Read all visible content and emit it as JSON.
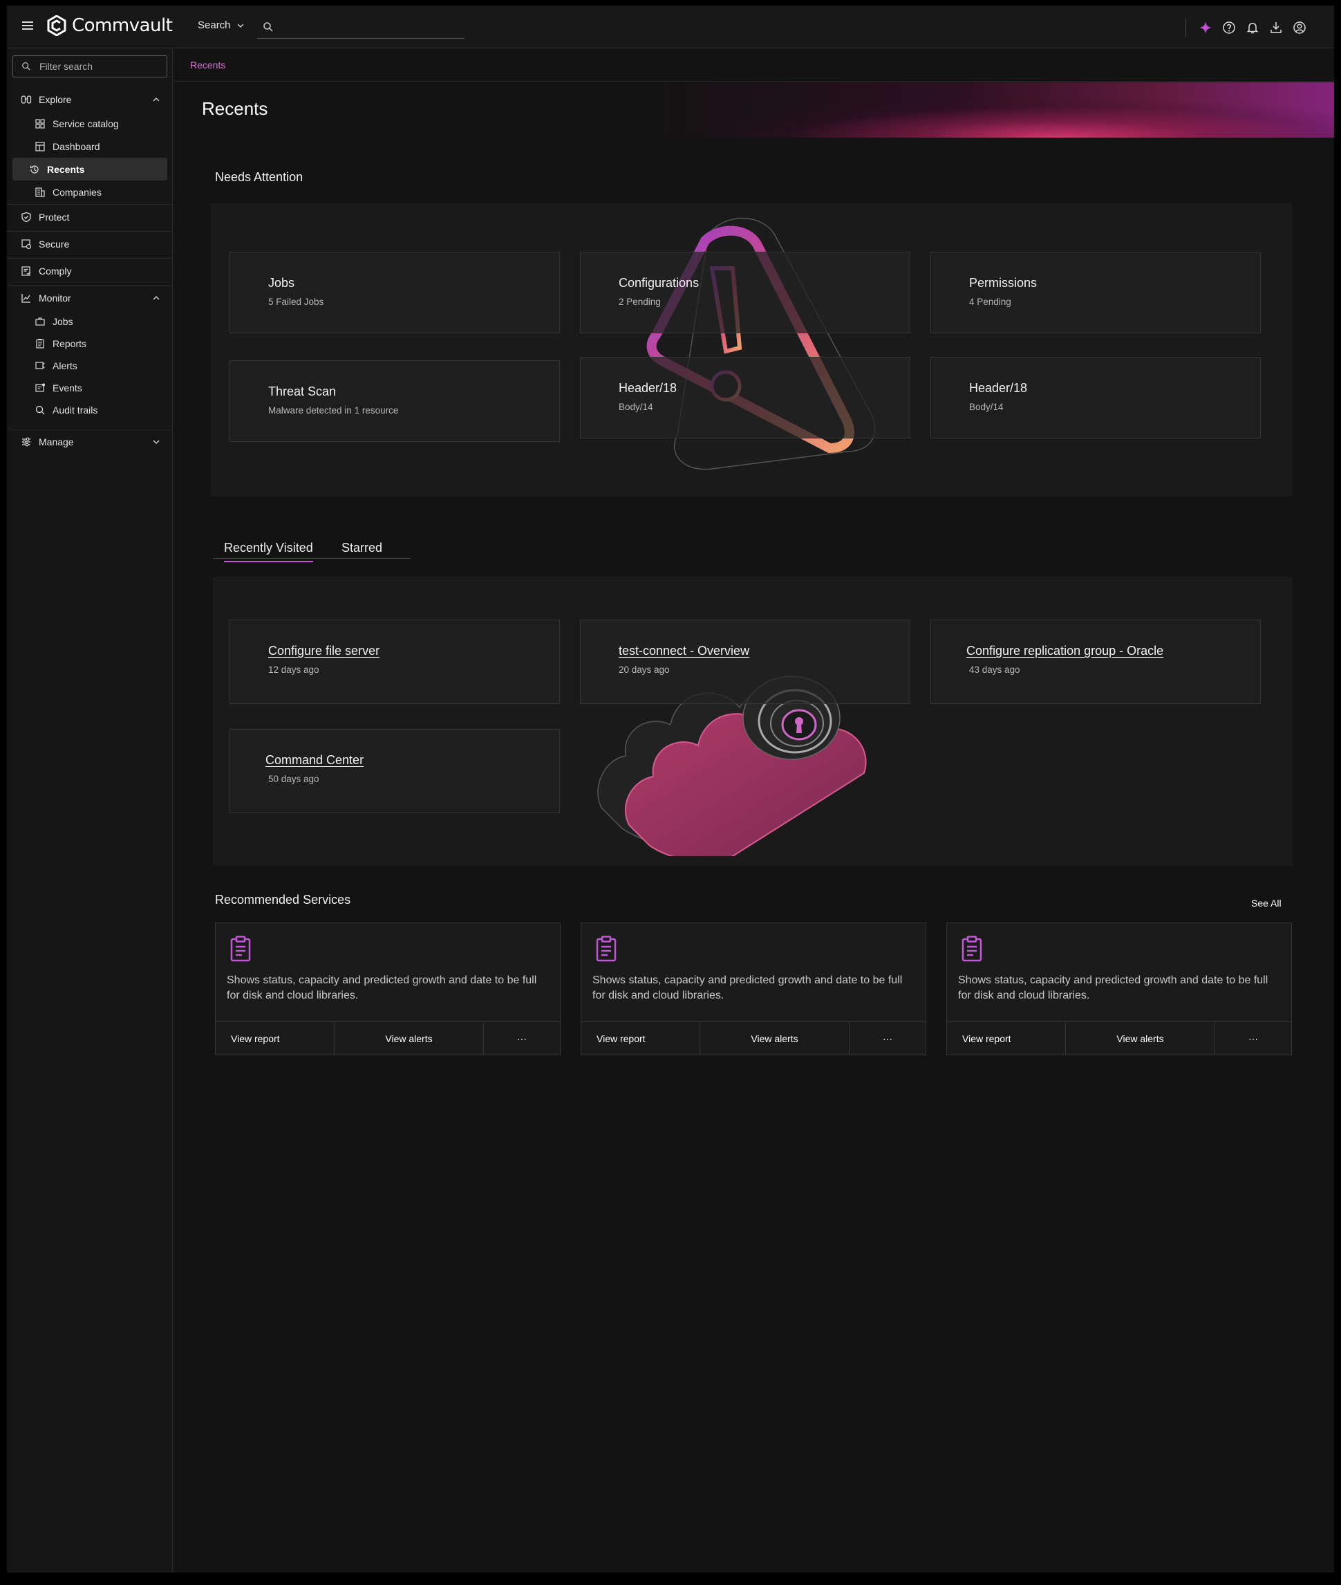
{
  "header": {
    "brand": "Commvault",
    "search_scope": "Search",
    "search_placeholder": "",
    "accent_color": "#c159d6"
  },
  "sidebar": {
    "filter_placeholder": "Filter search",
    "explore": {
      "label": "Explore",
      "items": [
        "Service catalog",
        "Dashboard",
        "Recents",
        "Companies"
      ]
    },
    "protect": "Protect",
    "secure": "Secure",
    "comply": "Comply",
    "monitor": {
      "label": "Monitor",
      "items": [
        "Jobs",
        "Reports",
        "Alerts",
        "Events",
        "Audit trails"
      ]
    },
    "manage": "Manage"
  },
  "breadcrumb": "Recents",
  "page_title": "Recents",
  "needs_attention": {
    "title": "Needs Attention",
    "cards": [
      {
        "title": "Jobs",
        "subtitle": "5 Failed Jobs"
      },
      {
        "title": "Configurations",
        "subtitle": "2 Pending"
      },
      {
        "title": "Permissions",
        "subtitle": "4 Pending"
      },
      {
        "title": "Threat Scan",
        "subtitle": "Malware detected in 1 resource"
      },
      {
        "title": "Header/18",
        "subtitle": "Body/14"
      },
      {
        "title": "Header/18",
        "subtitle": "Body/14"
      }
    ]
  },
  "recent_tabs": [
    "Recently Visited",
    "Starred"
  ],
  "recently_visited": [
    {
      "title": "Configure file server",
      "subtitle": "12 days ago"
    },
    {
      "title": "test-connect - Overview",
      "subtitle": "20 days ago"
    },
    {
      "title": "Configure replication group - Oracle",
      "subtitle": "43 days ago"
    },
    {
      "title": "Command Center",
      "subtitle": "50 days ago"
    }
  ],
  "recommended": {
    "title": "Recommended Services",
    "see_all": "See All",
    "services": [
      {
        "icon": "clipboard-icon",
        "description": "Shows status, capacity and predicted growth and date to be full for disk and cloud libraries.",
        "action1": "View report",
        "action2": "View alerts",
        "more": "···"
      },
      {
        "icon": "clipboard-icon",
        "description": "Shows status, capacity and predicted growth and date to be full for disk and cloud libraries.",
        "action1": "View report",
        "action2": "View alerts",
        "more": "···"
      },
      {
        "icon": "clipboard-icon",
        "description": "Shows status, capacity and predicted growth and date to be full for disk and cloud libraries.",
        "action1": "View report",
        "action2": "View alerts",
        "more": "···"
      }
    ]
  }
}
